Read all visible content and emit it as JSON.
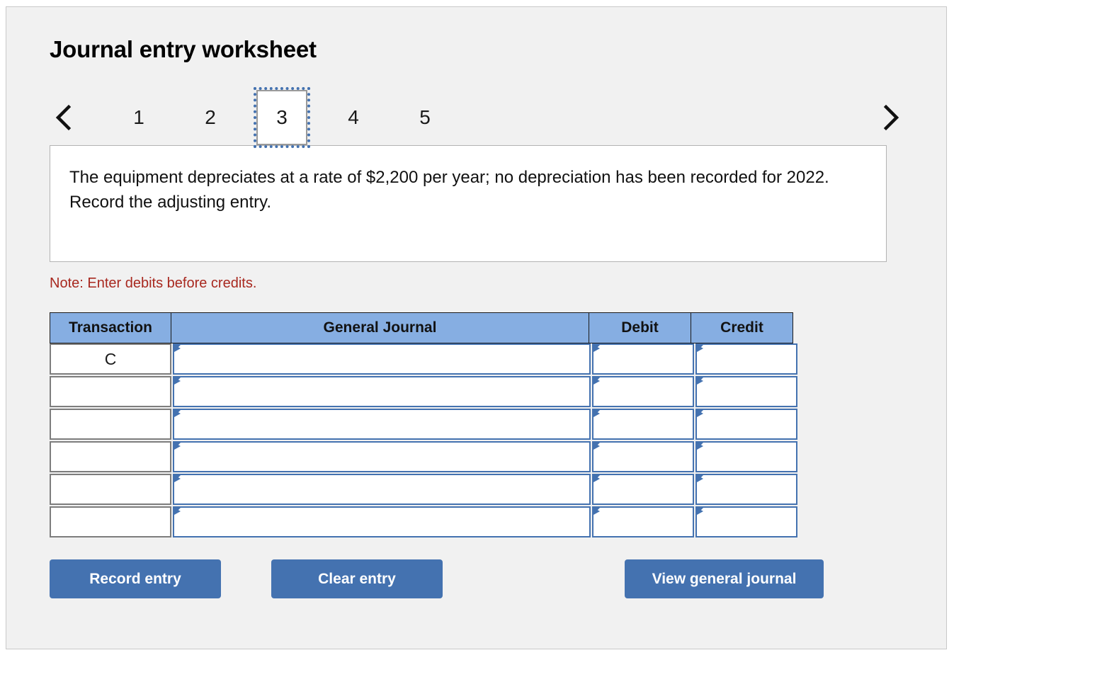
{
  "worksheet": {
    "title": "Journal entry worksheet",
    "note": "Note: Enter debits before credits.",
    "question": "The equipment depreciates at a rate of $2,200 per year; no depreciation has been recorded for 2022. Record the adjusting entry."
  },
  "pager": {
    "prev_icon": "chevron-left-icon",
    "next_icon": "chevron-right-icon",
    "tabs": [
      {
        "label": "1",
        "selected": false
      },
      {
        "label": "2",
        "selected": false
      },
      {
        "label": "3",
        "selected": true
      },
      {
        "label": "4",
        "selected": false
      },
      {
        "label": "5",
        "selected": false
      }
    ],
    "selected_tab": "3"
  },
  "table": {
    "headers": {
      "transaction": "Transaction",
      "general_journal": "General Journal",
      "debit": "Debit",
      "credit": "Credit"
    },
    "rows": [
      {
        "transaction": "C",
        "general_journal": "",
        "debit": "",
        "credit": ""
      },
      {
        "transaction": "",
        "general_journal": "",
        "debit": "",
        "credit": ""
      },
      {
        "transaction": "",
        "general_journal": "",
        "debit": "",
        "credit": ""
      },
      {
        "transaction": "",
        "general_journal": "",
        "debit": "",
        "credit": ""
      },
      {
        "transaction": "",
        "general_journal": "",
        "debit": "",
        "credit": ""
      },
      {
        "transaction": "",
        "general_journal": "",
        "debit": "",
        "credit": ""
      }
    ]
  },
  "buttons": {
    "record": "Record entry",
    "clear": "Clear entry",
    "view": "View general journal"
  },
  "colors": {
    "header_blue": "#86aee2",
    "button_blue": "#4472b0",
    "note_red": "#a8281f",
    "panel_bg": "#f1f1f1",
    "panel_border": "#c9c9c9"
  }
}
